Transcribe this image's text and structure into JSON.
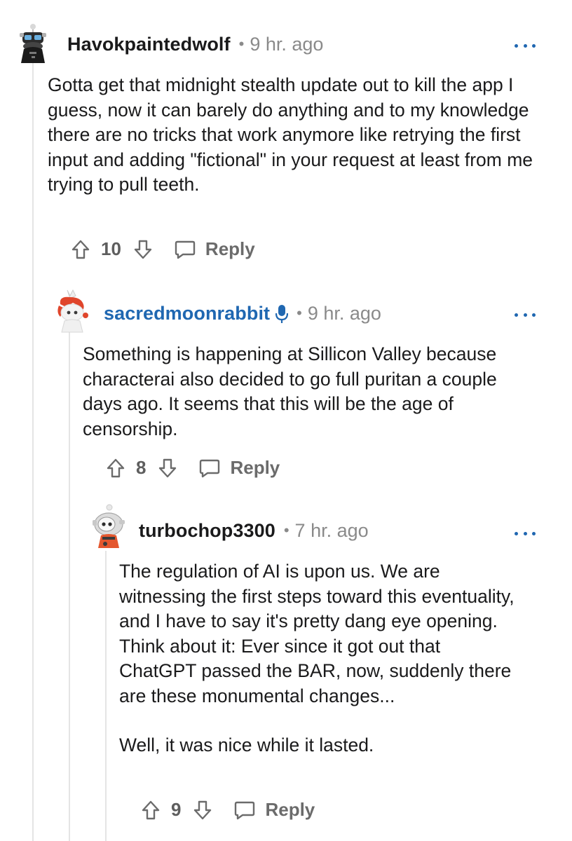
{
  "comments": [
    {
      "username": "Havokpaintedwolf",
      "time": "9 hr. ago",
      "paragraphs": [
        "Gotta get that midnight stealth update out to kill the app I guess, now it can barely do anything and to my knowledge there are no tricks that work anymore like retrying the first input and adding \"fictional\" in your request at least from me trying to pull teeth."
      ],
      "votes": "10",
      "reply_label": "Reply",
      "separator": "•"
    },
    {
      "username": "sacredmoonrabbit",
      "time": "9 hr. ago",
      "paragraphs": [
        "Something is happening at Sillicon Valley because characterai also decided to go full puritan a couple days ago. It seems that this will be the age of censorship."
      ],
      "votes": "8",
      "reply_label": "Reply",
      "separator": "•",
      "username_color": "#1f67b1",
      "badge_icon": "microphone-icon"
    },
    {
      "username": "turbochop3300",
      "time": "7 hr. ago",
      "paragraphs": [
        "The regulation of AI is upon us. We are witnessing the first steps toward this eventuality, and I have to say it's pretty dang eye opening. Think about it: Ever since it got out that ChatGPT passed the BAR, now, suddenly there are these monumental changes...",
        "Well, it was nice while it lasted."
      ],
      "votes": "9",
      "reply_label": "Reply",
      "separator": "•"
    }
  ],
  "colors": {
    "accent": "#1f67b1",
    "meta": "#8a8a8a",
    "thread_line": "#e4e4e4"
  }
}
